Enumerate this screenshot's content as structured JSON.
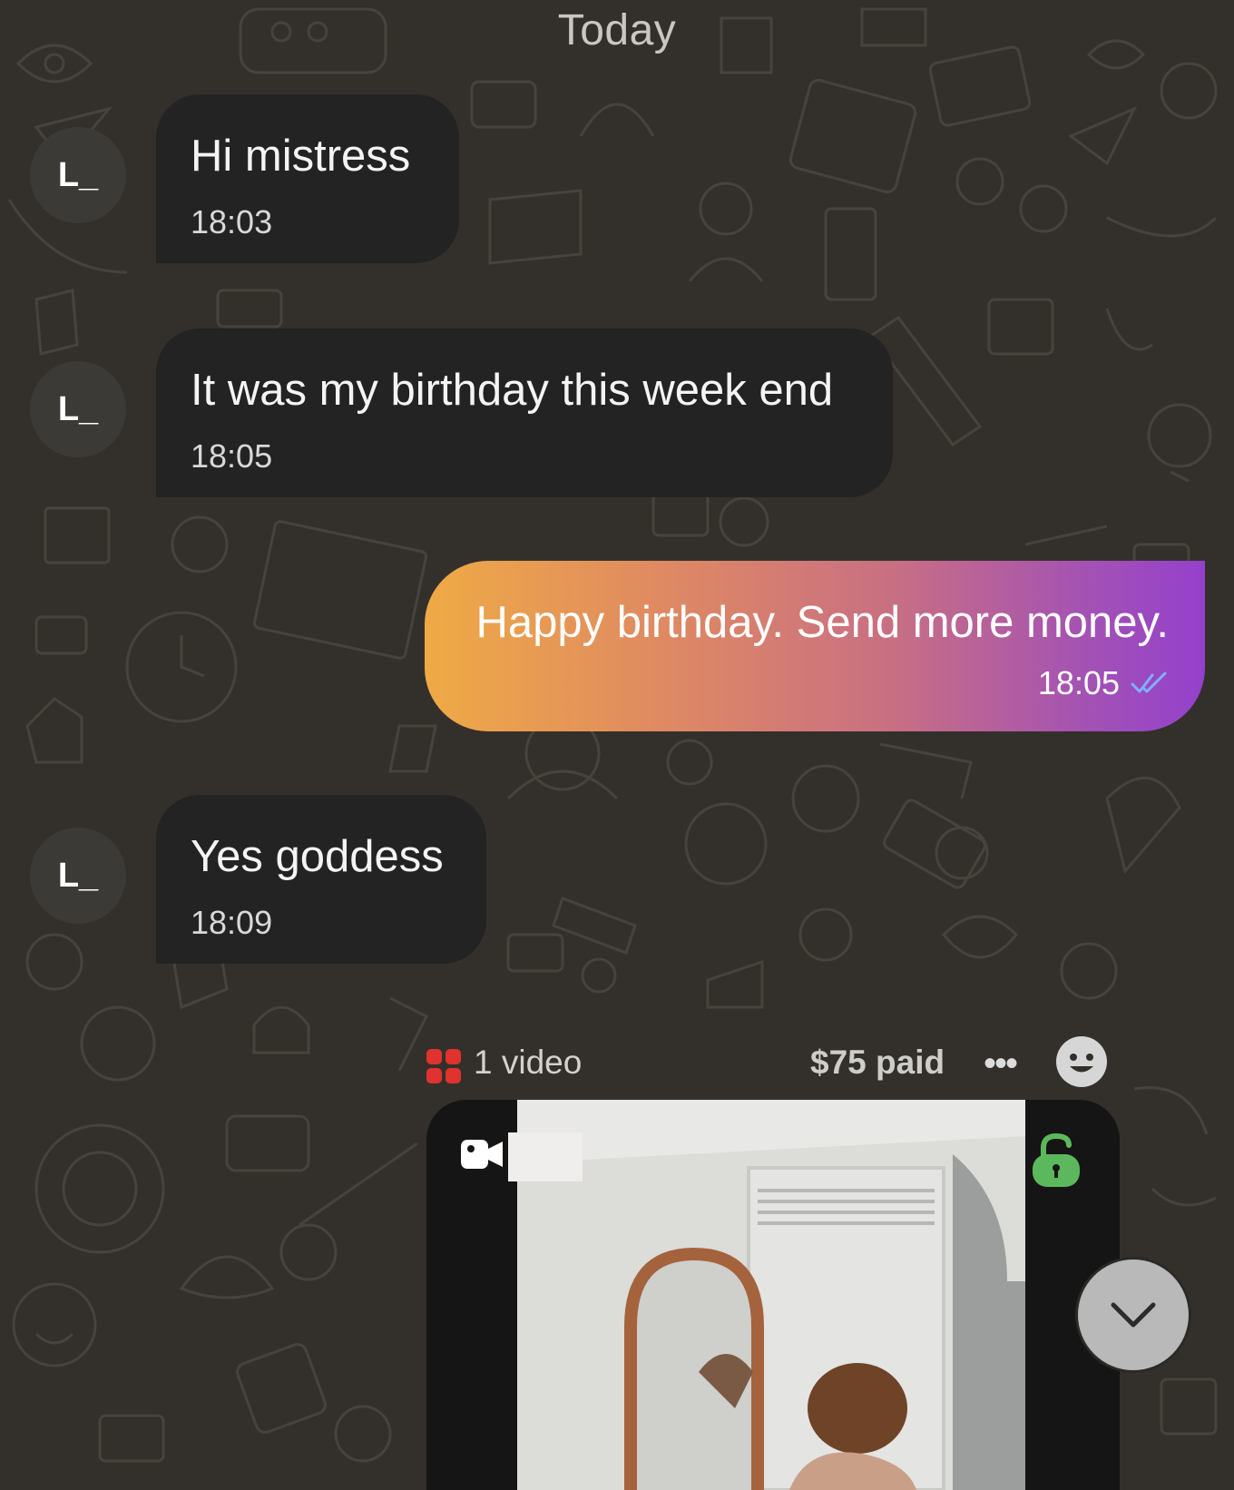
{
  "chat": {
    "date_divider": "Today",
    "messages": [
      {
        "direction": "incoming",
        "avatar_initials": "L_",
        "text": "Hi mistress",
        "time": "18:03"
      },
      {
        "direction": "incoming",
        "avatar_initials": "L_",
        "text": "It was my birthday this week end",
        "time": "18:05"
      },
      {
        "direction": "outgoing",
        "text": "Happy birthday. Send more money.",
        "time": "18:05",
        "status": "read"
      },
      {
        "direction": "incoming",
        "avatar_initials": "L_",
        "text": "Yes goddess",
        "time": "18:09"
      }
    ],
    "media_message": {
      "media_count": "1 video",
      "price_status": "$75 paid",
      "more_label": "•••",
      "lock_state": "unlocked"
    }
  },
  "colors": {
    "background": "#33302b",
    "incoming_bubble": "#232323",
    "outgoing_gradient_start": "#efaa45",
    "outgoing_gradient_end": "#9440cc",
    "read_ticks": "#7fb0ff",
    "media_icon": "#e0322e",
    "lock_icon": "#5cb85c"
  },
  "icons": [
    "media-grid-icon",
    "emoji-icon",
    "video-camera-icon",
    "unlock-icon",
    "chevron-down-icon",
    "double-check-icon"
  ]
}
